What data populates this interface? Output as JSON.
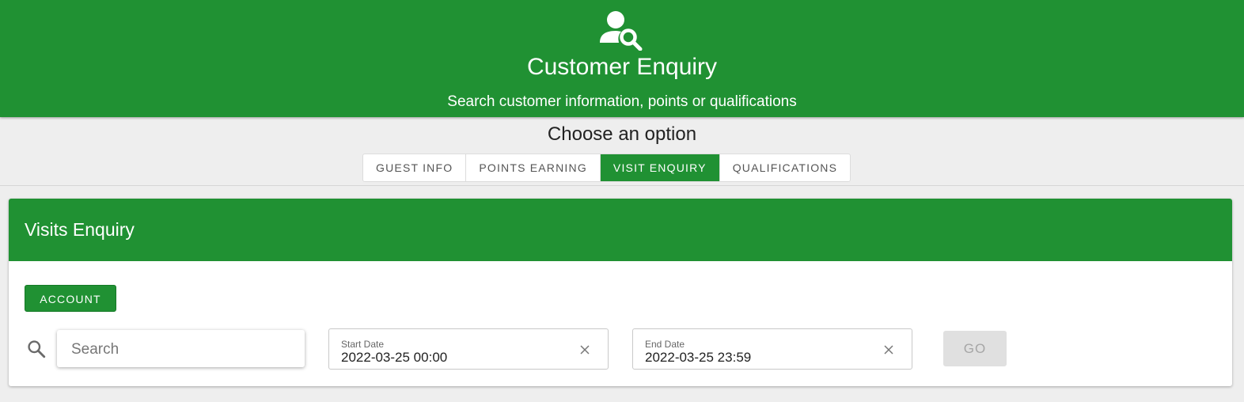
{
  "header": {
    "icon": "user-search-icon",
    "title": "Customer Enquiry",
    "subtitle": "Search customer information, points or qualifications"
  },
  "options": {
    "label": "Choose an option",
    "tabs": [
      {
        "label": "GUEST INFO",
        "active": false
      },
      {
        "label": "POINTS EARNING",
        "active": false
      },
      {
        "label": "VISIT ENQUIRY",
        "active": true
      },
      {
        "label": "QUALIFICATIONS",
        "active": false
      }
    ]
  },
  "panel": {
    "title": "Visits Enquiry",
    "account_button": "ACCOUNT",
    "search": {
      "icon": "search-icon",
      "placeholder": "Search",
      "value": ""
    },
    "start_date": {
      "label": "Start Date",
      "value": "2022-03-25 00:00"
    },
    "end_date": {
      "label": "End Date",
      "value": "2022-03-25 23:59"
    },
    "go_button": "GO"
  },
  "colors": {
    "accent": "#209133",
    "background": "#eeeeee",
    "disabled": "#e0e0e0"
  }
}
